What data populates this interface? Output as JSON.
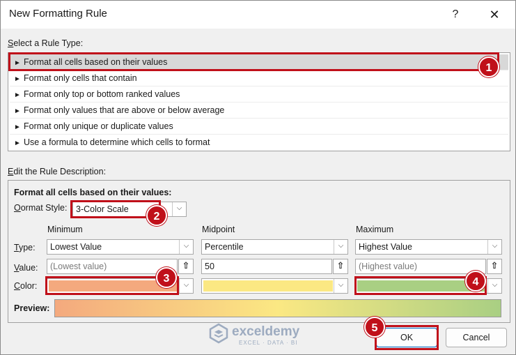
{
  "window": {
    "title": "New Formatting Rule",
    "help_label": "?",
    "close_label": "✕"
  },
  "rule_type": {
    "label": "Select a Rule Type:",
    "items": [
      {
        "label": "Format all cells based on their values",
        "selected": true
      },
      {
        "label": "Format only cells that contain"
      },
      {
        "label": "Format only top or bottom ranked values"
      },
      {
        "label": "Format only values that are above or below average"
      },
      {
        "label": "Format only unique or duplicate values"
      },
      {
        "label": "Use a formula to determine which cells to format"
      }
    ]
  },
  "description": {
    "label": "Edit the Rule Description:",
    "heading": "Format all cells based on their values:",
    "format_style_label": "Format Style:",
    "format_style_value": "3-Color Scale",
    "row_labels": {
      "type": "Type:",
      "value": "Value:",
      "color": "Color:"
    },
    "columns": [
      {
        "header": "Minimum",
        "type": "Lowest Value",
        "value": "(Lowest value)",
        "value_is_placeholder": true,
        "color": "#f4a97e"
      },
      {
        "header": "Midpoint",
        "type": "Percentile",
        "value": "50",
        "value_is_placeholder": false,
        "color": "#fbe883"
      },
      {
        "header": "Maximum",
        "type": "Highest Value",
        "value": "(Highest value)",
        "value_is_placeholder": true,
        "color": "#a9cf83"
      }
    ],
    "preview_label": "Preview:"
  },
  "buttons": {
    "ok": "OK",
    "cancel": "Cancel"
  },
  "callouts": [
    "1",
    "2",
    "3",
    "4",
    "5"
  ],
  "watermark": {
    "name": "exceldemy",
    "tagline": "EXCEL · DATA · BI"
  },
  "icons": {
    "dropdown": "chevron-down-icon",
    "cell_selector": "collapse-dialog-icon",
    "rule_arrow": "triangle-right-icon"
  }
}
